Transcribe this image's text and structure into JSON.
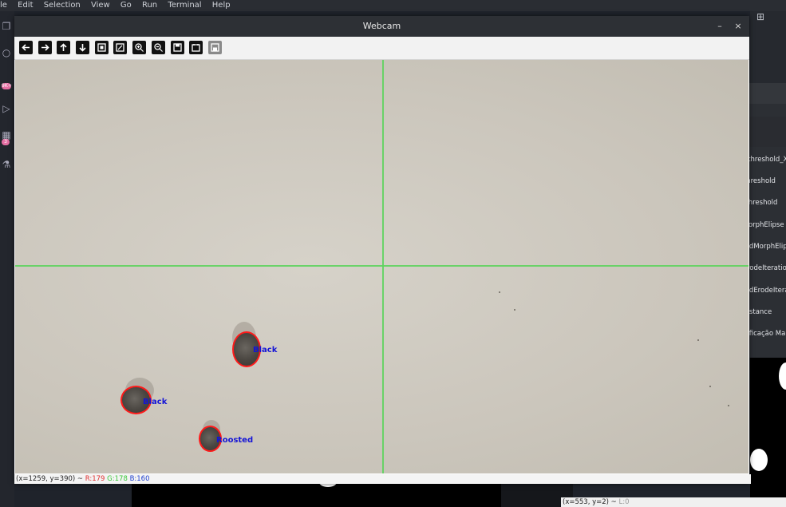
{
  "background": {
    "menu": [
      "le",
      "Edit",
      "Selection",
      "View",
      "Go",
      "Run",
      "Terminal",
      "Help"
    ],
    "activity_badges": [
      "9K+",
      "3"
    ]
  },
  "webcam": {
    "title": "Webcam",
    "minimize_label": "–",
    "close_label": "×",
    "toolbar": [
      "pan-left-icon",
      "pan-right-icon",
      "pan-up-icon",
      "pan-down-icon",
      "zoom-reset-icon",
      "zoom-fit-icon",
      "zoom-in-icon",
      "zoom-out-icon",
      "save-icon",
      "properties-icon",
      "save-disabled-icon"
    ],
    "status": {
      "coords": "(x=1259, y=390) ~",
      "r": "R:179",
      "g": "G:178",
      "b": "B:160"
    },
    "detections": [
      {
        "label": "Black"
      },
      {
        "label": "Black"
      },
      {
        "label": "Roosted"
      }
    ]
  },
  "trackbars": {
    "labels": [
      "area_threshold_X",
      "minThreshold",
      "maxThreshold",
      "firstMorphElipse",
      "secondMorphElip",
      "firstErodeIteratio",
      "secondErodeItera",
      "minDistance",
      "Classificação Ma"
    ]
  },
  "status2": {
    "coords": "(x=553, y=2) ~",
    "dim": "L:0"
  }
}
